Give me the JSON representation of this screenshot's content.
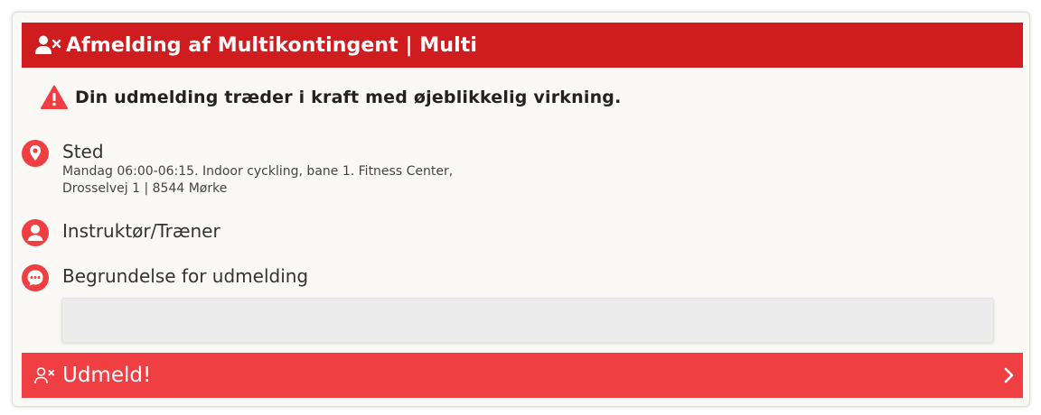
{
  "header": {
    "title": "Afmelding af Multikontingent | Multi",
    "icon": "user-remove-icon"
  },
  "warning": {
    "text": "Din udmelding træder i kraft med øjeblikkelig virkning.",
    "icon": "warning-icon"
  },
  "location": {
    "label": "Sted",
    "detail_line1": "Mandag 06:00-06:15. Indoor cyckling, bane 1. Fitness Center,",
    "detail_line2": "Drosselvej 1 | 8544 Mørke",
    "icon": "location-pin-icon"
  },
  "instructor": {
    "label": "Instruktør/Træner",
    "icon": "person-icon"
  },
  "reason": {
    "label": "Begrundelse for udmelding",
    "value": "",
    "placeholder": "",
    "icon": "chat-icon"
  },
  "submit": {
    "label": "Udmeld!",
    "icon": "user-remove-icon",
    "arrow_icon": "chevron-right-icon"
  },
  "colors": {
    "header_bg": "#cf1c1f",
    "accent": "#ef3f42",
    "card_bg": "#fbf9f5"
  }
}
